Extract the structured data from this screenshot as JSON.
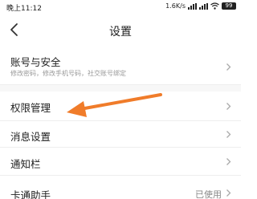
{
  "status_bar": {
    "time": "晚上11:12",
    "network_speed": "1.6K/s",
    "battery": "99"
  },
  "header": {
    "title": "设置"
  },
  "settings": {
    "items": [
      {
        "label": "账号与安全",
        "subtitle": "修改密码，修改手机号码，社交账号绑定"
      },
      {
        "label": "权限管理"
      },
      {
        "label": "消息设置"
      },
      {
        "label": "通知栏"
      },
      {
        "label": "卡通助手",
        "value": "已使用"
      }
    ]
  },
  "annotation": {
    "color": "#f07c2a",
    "target": "权限管理"
  }
}
